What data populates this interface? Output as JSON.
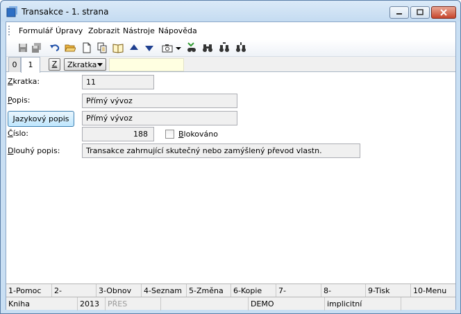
{
  "window": {
    "title": "Transakce - 1. strana"
  },
  "menu": [
    "Formulář",
    "Úpravy",
    "Zobrazit",
    "Nástroje",
    "Nápověda"
  ],
  "toolbar": {
    "icons": [
      "save-icon",
      "save-all-icon",
      "undo-icon",
      "open-folder-icon",
      "new-document-icon",
      "copy-icon",
      "book-icon",
      "arrow-up-icon",
      "arrow-down-icon",
      "camera-icon",
      "dropdown-arrow-icon",
      "filter-binoculars-icon",
      "binoculars-icon",
      "binoculars-next-icon",
      "binoculars-prev-icon"
    ]
  },
  "tabs": {
    "items": [
      "0",
      "1"
    ],
    "active": "1",
    "z_label": "Z",
    "combo_value": "Zkratka"
  },
  "form": {
    "zkratka_label": "Zkratka:",
    "zkratka_value": "11",
    "popis_label": "Popis:",
    "popis_value": "Přímý vývoz",
    "jazykovy_button": "Jazykový popis",
    "jazykovy_value": "Přímý vývoz",
    "cislo_label": "Číslo:",
    "cislo_value": "188",
    "blokovano_label": "Blokováno",
    "blokovano_checked": false,
    "dlouhy_label": "Dlouhý popis:",
    "dlouhy_value": "Transakce zahrnující skutečný nebo zamýšlený převod vlastn."
  },
  "fkeys": [
    "1-Pomoc",
    "2-",
    "3-Obnov",
    "4-Seznam",
    "5-Změna",
    "6-Kopie",
    "7-",
    "8-",
    "9-Tisk",
    "10-Menu"
  ],
  "status": {
    "book": "Kniha",
    "year": "2013",
    "mode": "PŘES",
    "db": "DEMO",
    "profile": "implicitní"
  }
}
